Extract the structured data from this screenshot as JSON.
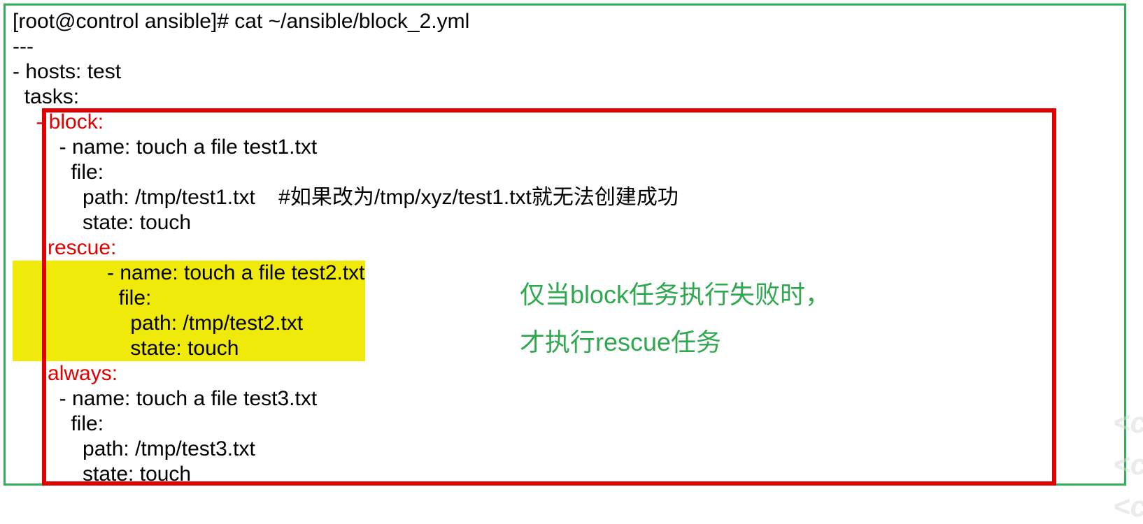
{
  "prompt": "[root@control ansible]# cat ~/ansible/block_2.yml",
  "l1": "---",
  "l2": "- hosts: test",
  "l3": "  tasks:",
  "k_block": "    - block:",
  "b1": "        - name: touch a file test1.txt",
  "b2": "          file:",
  "b3": "            path: /tmp/test1.txt    #如果改为/tmp/xyz/test1.txt就无法创建成功",
  "b4": "            state: touch",
  "k_rescue": "      rescue:",
  "r1": "        - name: touch a file test2.txt",
  "r2": "          file:",
  "r3": "            path: /tmp/test2.txt",
  "r4": "            state: touch",
  "k_always": "      always:",
  "a1": "        - name: touch a file test3.txt",
  "a2": "          file:",
  "a3": "            path: /tmp/test3.txt",
  "a4": "            state: touch",
  "note1": "仅当block任务执行失败时，",
  "note2": "才执行rescue任务",
  "wm": "<c"
}
